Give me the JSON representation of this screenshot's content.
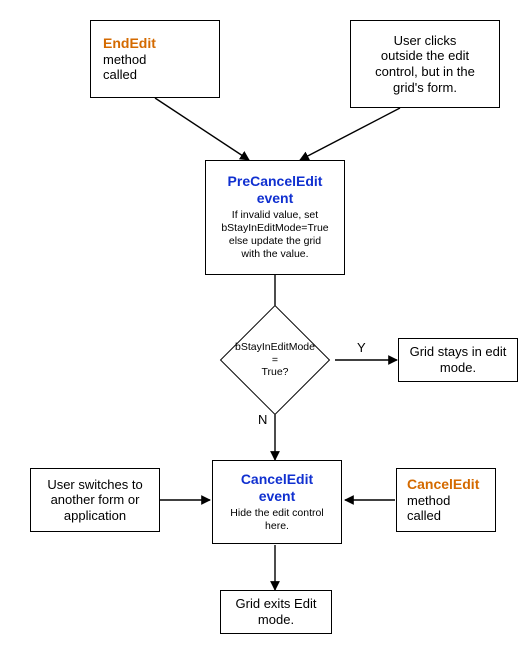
{
  "chart_data": {
    "type": "flowchart",
    "nodes": [
      {
        "id": "endedit",
        "kind": "process",
        "title": "EndEdit",
        "title_color": "orange",
        "subtitle": "method called"
      },
      {
        "id": "clickoutside",
        "kind": "process",
        "text": "User clicks outside the edit control, but in the grid's form."
      },
      {
        "id": "precancel",
        "kind": "process",
        "title": "PreCancelEdit event",
        "title_color": "blue",
        "detail": "If invalid value, set bStayInEditMode=True else update the grid with the value."
      },
      {
        "id": "decision",
        "kind": "decision",
        "text": "bStayInEditMode = True?"
      },
      {
        "id": "stays",
        "kind": "terminator",
        "text": "Grid stays in edit mode."
      },
      {
        "id": "switchform",
        "kind": "process",
        "text": "User switches to another form or application"
      },
      {
        "id": "canceledit",
        "kind": "process",
        "title": "CancelEdit event",
        "title_color": "blue",
        "detail": "Hide the edit control here."
      },
      {
        "id": "cancelmethod",
        "kind": "process",
        "title": "CancelEdit",
        "title_color": "orange",
        "subtitle": "method called"
      },
      {
        "id": "exits",
        "kind": "terminator",
        "text": "Grid exits Edit mode."
      }
    ],
    "edges": [
      {
        "from": "endedit",
        "to": "precancel"
      },
      {
        "from": "clickoutside",
        "to": "precancel"
      },
      {
        "from": "precancel",
        "to": "decision"
      },
      {
        "from": "decision",
        "to": "stays",
        "label": "Y"
      },
      {
        "from": "decision",
        "to": "canceledit",
        "label": "N"
      },
      {
        "from": "switchform",
        "to": "canceledit"
      },
      {
        "from": "cancelmethod",
        "to": "canceledit"
      },
      {
        "from": "canceledit",
        "to": "exits"
      }
    ]
  },
  "nodes": {
    "endedit": {
      "title": "EndEdit",
      "sub": "method\ncalled"
    },
    "clickoutside": {
      "text": "User clicks\noutside the edit\ncontrol, but in the\ngrid's form."
    },
    "precancel": {
      "title": "PreCancelEdit\nevent",
      "detail": "If invalid value, set\nbStayInEditMode=True\nelse update the grid\nwith the value."
    },
    "decision": {
      "l1": "bStayInEditMode",
      "l2": "=",
      "l3": "True?"
    },
    "stays": {
      "text": "Grid stays in edit\nmode."
    },
    "switchform": {
      "text": "User switches to\nanother form or\napplication"
    },
    "canceledit": {
      "title": "CancelEdit\nevent",
      "detail": "Hide the edit control\nhere."
    },
    "cancelmethod": {
      "title": "CancelEdit",
      "sub": "method\ncalled"
    },
    "exits": {
      "text": "Grid exits Edit\nmode."
    }
  },
  "labels": {
    "yes": "Y",
    "no": "N"
  }
}
